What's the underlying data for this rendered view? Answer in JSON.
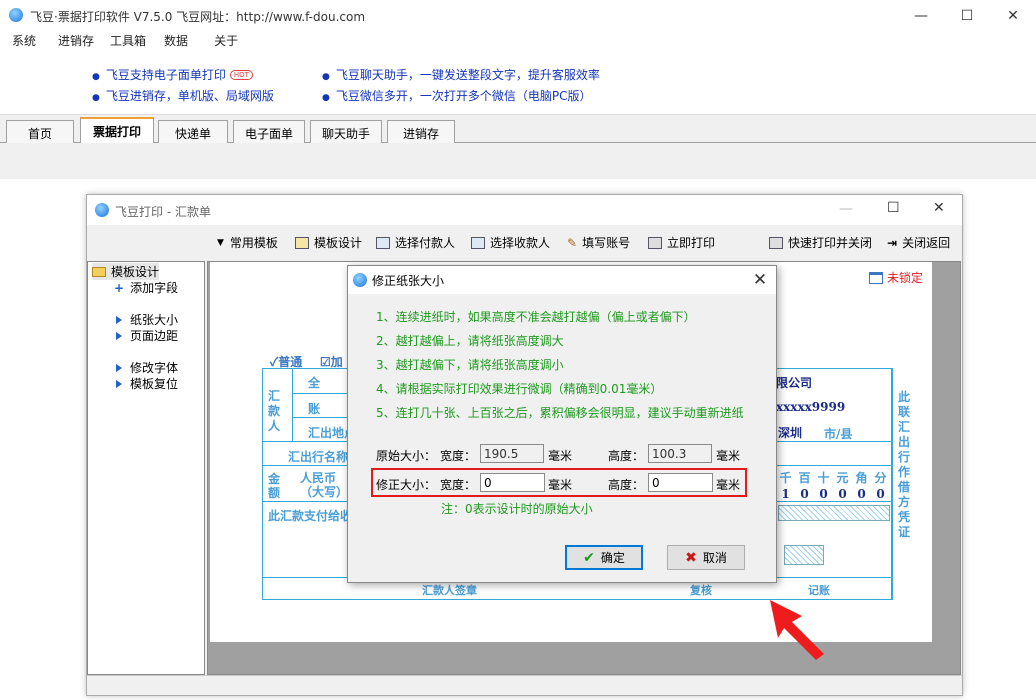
{
  "app": {
    "title": "飞豆·票据打印软件 V7.5.0   飞豆网址：http://www.f-dou.com",
    "window_controls": {
      "minimize": "—",
      "maximize": "☐",
      "close": "✕"
    }
  },
  "menu": [
    "系统",
    "进销存",
    "工具箱",
    "数据",
    "关于"
  ],
  "ads": {
    "col1": [
      "飞豆支持电子面单打印",
      "飞豆进销存，单机版、局域网版"
    ],
    "hot_badge": "HOT",
    "col2": [
      "飞豆聊天助手，一键发送整段文字，提升客服效率",
      "飞豆微信多开，一次打开多个微信（电脑PC版）"
    ]
  },
  "tabs": [
    "首页",
    "票据打印",
    "快递单",
    "电子面单",
    "聊天助手",
    "进销存"
  ],
  "active_tab": "票据打印",
  "inner_window": {
    "title": "飞豆打印 - 汇款单",
    "toolbar": {
      "templates": "常用模板",
      "design": "模板设计",
      "payer": "选择付款人",
      "payee": "选择收款人",
      "account": "填写账号",
      "print": "立即打印",
      "quick_print": "快速打印并关闭",
      "close": "关闭返回"
    },
    "tree": {
      "root": "模板设计",
      "items": [
        "添加字段",
        "纸张大小",
        "页面边距",
        "修改字体",
        "模板复位"
      ]
    },
    "lock_status": "未锁定",
    "form": {
      "normal": "普通",
      "add": "加",
      "remitter": "汇款人",
      "fullname": "全",
      "account": "账",
      "origin": "汇出地点",
      "bank_name": "汇出行名称",
      "amount": "金额",
      "rmb": "人民币（大写）",
      "notice": "此汇款支付给收",
      "company_tail": "限公司",
      "acct_tail": "xxxxx9999",
      "city": "深圳",
      "city_label": "市/县",
      "units": [
        "千",
        "百",
        "十",
        "元",
        "角",
        "分"
      ],
      "digits": [
        "1",
        "0",
        "0",
        "0",
        "0",
        "0"
      ],
      "side_note": "此联汇出行作借方凭证",
      "sign": "汇款人签章",
      "review": "复核",
      "bookkeep": "记账"
    }
  },
  "dialog": {
    "title": "修正纸张大小",
    "instructions": [
      "1、连续进纸时，如果高度不准会越打越偏（偏上或者偏下）",
      "2、越打越偏上，请将纸张高度调大",
      "3、越打越偏下，请将纸张高度调小",
      "4、请根据实际打印效果进行微调（精确到0.01毫米）",
      "5、连打几十张、上百张之后，累积偏移会很明显，建议手动重新进纸"
    ],
    "original_label": "原始大小：",
    "width_label": "宽度：",
    "height_label": "高度：",
    "unit": "毫米",
    "original_width": "190.5",
    "original_height": "100.3",
    "corrected_label": "修正大小：",
    "corrected_width": "0",
    "corrected_height": "0",
    "note": "注：0表示设计时的原始大小",
    "ok": "确定",
    "cancel": "取消"
  }
}
